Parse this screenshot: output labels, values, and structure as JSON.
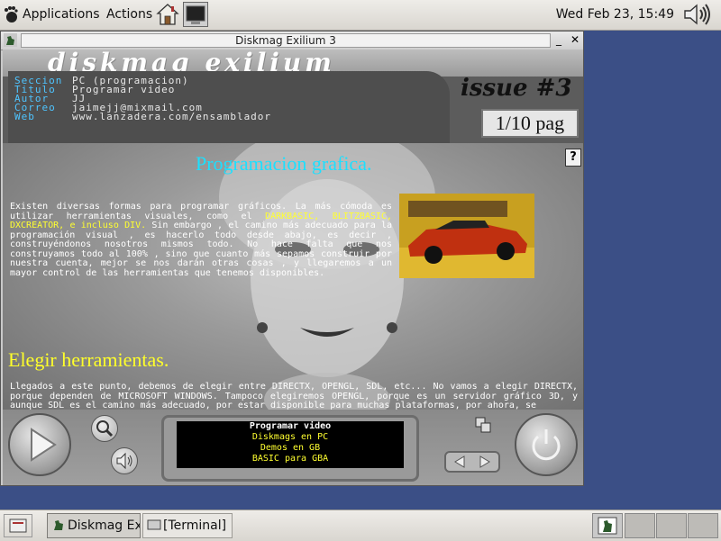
{
  "top_panel": {
    "applications": "Applications",
    "actions": "Actions",
    "clock": "Wed Feb 23, 15:49"
  },
  "window": {
    "title": "Diskmag Exilium 3",
    "controls": {
      "minimize": "_",
      "maximize": "□",
      "close": "✕"
    }
  },
  "app": {
    "logo": "diskmag exilium",
    "issue": "issue #3",
    "page_indicator": "1/10 pag",
    "info": [
      {
        "key": "Seccion",
        "value": "PC (programacion)"
      },
      {
        "key": "Titulo",
        "value": "Programar video"
      },
      {
        "key": "Autor",
        "value": "JJ"
      },
      {
        "key": "Correo",
        "value": "jaimejj@mixmail.com"
      },
      {
        "key": "Web",
        "value": "www.lanzadera.com/ensamblador"
      }
    ],
    "article": {
      "heading1": "Programacion grafica.",
      "para1_a": "Existen diversas formas para programar gráficos. La más cómoda es utilizar herramientas visuales, como el",
      "para1_highlight": "DARKBASIC, BLITZBASIC, DXCREATOR, e incluso DIV.",
      "para1_b": "Sin embargo , el camino más adecuado para la programación visual , es hacerlo todo desde abajo, es decir , construyéndonos nosotros mismos todo. No hace falta que nos construyamos todo al 100% , sino que cuanto más sepamos construir por nuestra cuenta, mejor se nos darán otras cosas , y llegaremos a un mayor control de las herramientas que tenemos disponibles.",
      "heading2": "Elegir herramientas.",
      "para2": "Llegados a este punto, debemos de elegir entre DIRECTX, OPENGL, SDL, etc... No vamos a elegir DIRECTX, porque dependen de MICROSOFT WINDOWS. Tampoco elegiremos OPENGL, porque es un servidor gráfico 3D, y aunque SDL es el camino más adecuado, por estar disponible para muchas plataformas, por ahora, se"
    },
    "menu": {
      "items": [
        "Programar video",
        "Diskmags en PC",
        "Demos en GB",
        "BASIC para GBA"
      ]
    }
  },
  "bottom_panel": {
    "task_diskmag": "Diskmag Exili",
    "task_terminal": "[Terminal]"
  }
}
